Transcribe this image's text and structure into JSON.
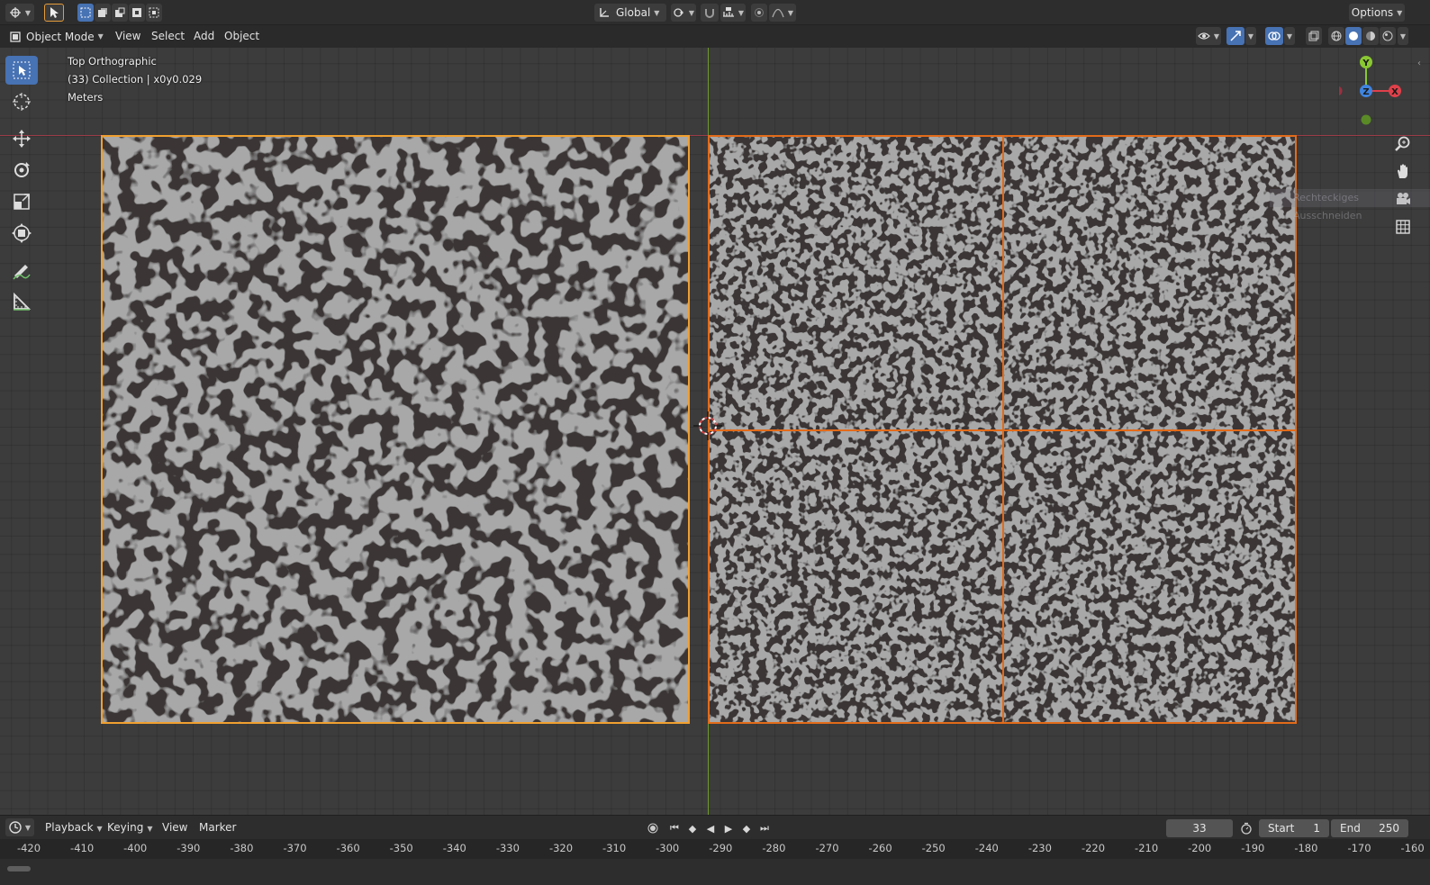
{
  "header": {
    "transform_orientation": "Global",
    "options_label": "Options"
  },
  "mode_bar": {
    "mode": "Object Mode",
    "menus": [
      "View",
      "Select",
      "Add",
      "Object"
    ]
  },
  "viewport": {
    "view_name": "Top Orthographic",
    "collection_info": "(33) Collection | x0y0.029",
    "units": "Meters",
    "gizmo_axes": {
      "x": "X",
      "y": "Y",
      "z": "Z"
    },
    "ghost_tooltip": "Rechteckiges Ausschneiden",
    "tools": [
      "select-box",
      "cursor",
      "move",
      "rotate",
      "scale",
      "transform",
      "annotate",
      "measure"
    ],
    "nav_tools": [
      "zoom-icon",
      "hand-pan-icon",
      "camera-icon",
      "grid-ortho-icon"
    ],
    "colors": {
      "selected_active": "#f0a030",
      "selected": "#e26b1a",
      "x_axis": "#9a3c48",
      "y_axis": "#6e9a2e",
      "active_tool": "#4772b3"
    }
  },
  "timeline": {
    "menus": [
      "Playback",
      "Keying",
      "View",
      "Marker"
    ],
    "current_frame": "33",
    "start_label": "Start",
    "start_value": "1",
    "end_label": "End",
    "end_value": "250",
    "ruler_ticks": [
      "-420",
      "-410",
      "-400",
      "-390",
      "-380",
      "-370",
      "-360",
      "-350",
      "-340",
      "-330",
      "-320",
      "-310",
      "-300",
      "-290",
      "-280",
      "-270",
      "-260",
      "-250",
      "-240",
      "-230",
      "-220",
      "-210",
      "-200",
      "-190",
      "-180",
      "-170",
      "-160"
    ]
  }
}
